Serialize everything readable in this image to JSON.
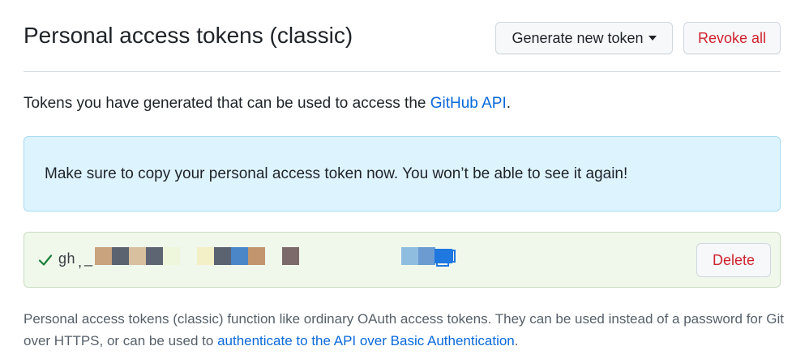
{
  "header": {
    "title": "Personal access tokens (classic)",
    "generate_label": "Generate new token",
    "revoke_label": "Revoke all"
  },
  "description": {
    "text": "Tokens you have generated that can be used to access the ",
    "link": "GitHub API",
    "suffix": "."
  },
  "flash": {
    "message": "Make sure to copy your personal access token now. You won’t be able to see it again!"
  },
  "token": {
    "prefix": "gh",
    "delete_label": "Delete",
    "redaction_colors": [
      "#c9a27e",
      "#5b6370",
      "#d8bf9e",
      "#5d6572",
      "#eef7dc",
      "#f3f0c8",
      "#5b6370",
      "#4a86c8",
      "#c2956e",
      "#7c6a6a",
      "#8fbde0",
      "#6b9bd0",
      "#1f77e0"
    ]
  },
  "footer": {
    "text": "Personal access tokens (classic) function like ordinary OAuth access tokens. They can be used instead of a password for Git over HTTPS, or can be used to ",
    "link": "authenticate to the API over Basic Authentication",
    "suffix": "."
  },
  "colors": {
    "danger": "#cf222e",
    "link": "#0969da",
    "flash_bg": "#ddf4ff",
    "token_bg": "#f0f8ec"
  }
}
